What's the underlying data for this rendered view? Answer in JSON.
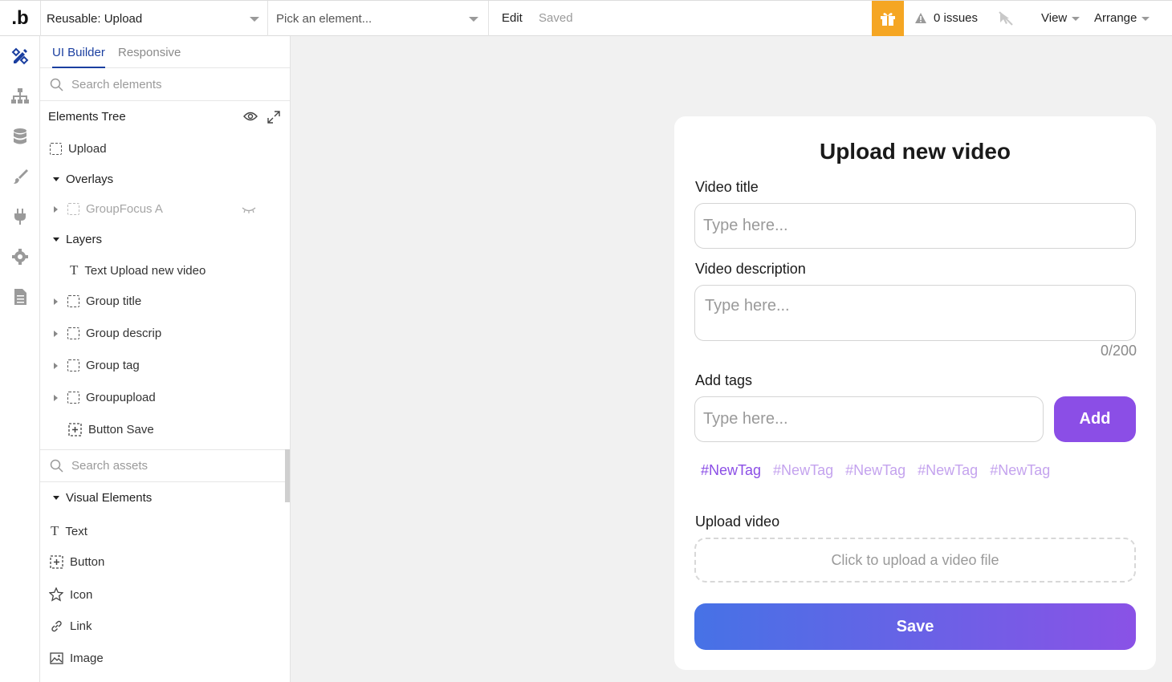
{
  "topbar": {
    "logo": ".b",
    "page_select": "Reusable: Upload",
    "element_select": "Pick an element...",
    "mode_edit": "Edit",
    "mode_saved": "Saved",
    "issues": "0 issues",
    "view": "View",
    "arrange": "Arrange",
    "gift_color": "#f5a623"
  },
  "panel": {
    "tabs": {
      "ui_builder": "UI Builder",
      "responsive": "Responsive"
    },
    "search_elements": "Search elements",
    "tree_title": "Elements Tree",
    "tree": {
      "upload": "Upload",
      "overlays": "Overlays",
      "groupfocus": "GroupFocus A",
      "layers": "Layers",
      "text_upload": "Text Upload new video",
      "group_title": "Group title",
      "group_descrip": "Group descrip",
      "group_tag": "Group tag",
      "groupupload": "Groupupload",
      "button_save": "Button Save"
    },
    "search_assets": "Search assets",
    "visual_elements": "Visual Elements",
    "assets": {
      "text": "Text",
      "button": "Button",
      "icon": "Icon",
      "link": "Link",
      "image": "Image"
    }
  },
  "card": {
    "title": "Upload new video",
    "video_title_label": "Video title",
    "video_title_placeholder": "Type here...",
    "video_desc_label": "Video description",
    "video_desc_placeholder": "Type here...",
    "counter": "0/200",
    "tags_label": "Add tags",
    "tags_placeholder": "Type here...",
    "add_label": "Add",
    "tags": [
      "#NewTag",
      "#NewTag",
      "#NewTag",
      "#NewTag",
      "#NewTag"
    ],
    "upload_label": "Upload video",
    "upload_zone": "Click to upload a video file",
    "save_label": "Save",
    "accent": "#8b4ee6"
  }
}
